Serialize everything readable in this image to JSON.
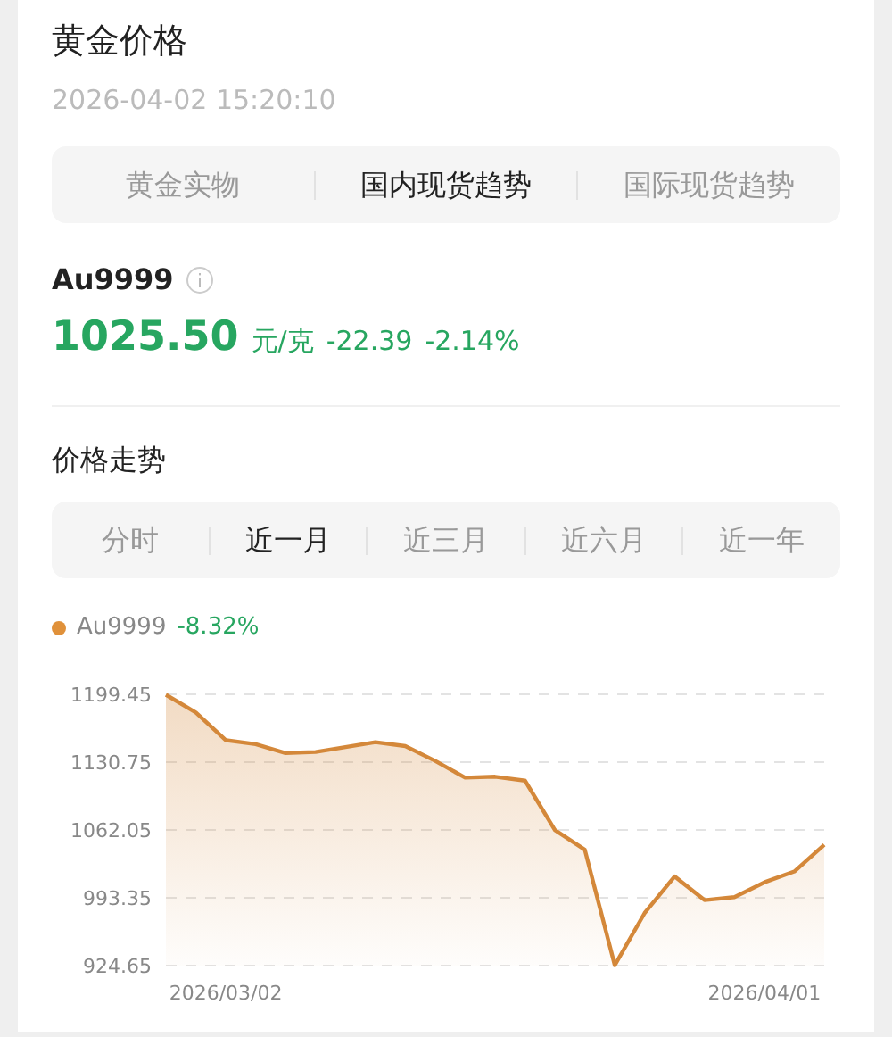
{
  "title": "黄金价格",
  "timestamp": "2026-04-02 15:20:10",
  "tabs": [
    {
      "label": "黄金实物",
      "selected": false
    },
    {
      "label": "国内现货趋势",
      "selected": true
    },
    {
      "label": "国际现货趋势",
      "selected": false
    }
  ],
  "quote": {
    "symbol": "Au9999",
    "price": "1025.50",
    "unit": "元/克",
    "change": "-22.39",
    "change_percent": "-2.14%"
  },
  "trend": {
    "title": "价格走势",
    "ranges": [
      {
        "label": "分时",
        "selected": false
      },
      {
        "label": "近一月",
        "selected": true
      },
      {
        "label": "近三月",
        "selected": false
      },
      {
        "label": "近六月",
        "selected": false
      },
      {
        "label": "近一年",
        "selected": false
      }
    ],
    "legend": {
      "change": "-8.32%",
      "color": "#e0913a"
    },
    "chart_data": {
      "type": "area",
      "categories": [
        null,
        null,
        "2026/03/02",
        null,
        null,
        null,
        null,
        null,
        null,
        null,
        null,
        null,
        null,
        null,
        null,
        null,
        null,
        null,
        null,
        null,
        "2026/04/01",
        null,
        null
      ],
      "series": [
        {
          "name": "Au9999",
          "color": "#d4883a",
          "values": [
            1199,
            1181,
            1153,
            1149,
            1140,
            1141,
            1146,
            1151,
            1147,
            1132,
            1115,
            1116,
            1112,
            1062,
            1042,
            925,
            978,
            1015,
            991,
            994,
            1009,
            1020,
            1047
          ]
        }
      ],
      "grid": true,
      "ylim": [
        924.65,
        1199.45
      ],
      "yticks": [
        924.65,
        993.35,
        1062.05,
        1130.75,
        1199.45
      ]
    }
  }
}
